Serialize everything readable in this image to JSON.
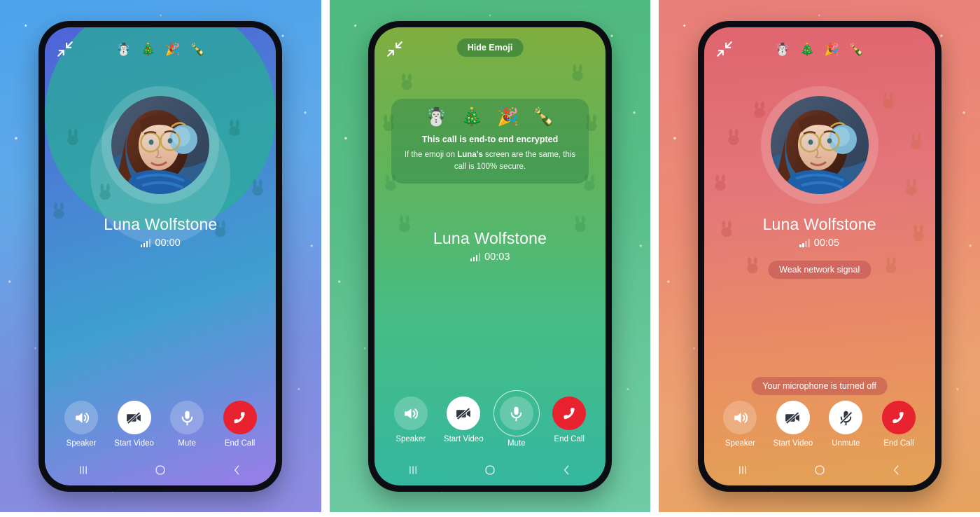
{
  "contact": {
    "name": "Luna Wolfstone",
    "short_name": "Luna"
  },
  "panels": [
    {
      "id": "panel-connecting",
      "theme": "blue-purple",
      "timer": "00:00",
      "name": "Luna Wolfstone",
      "top_emoji": [
        "☃️",
        "🎄",
        "🎉",
        "🍾"
      ],
      "show_avatar": true,
      "show_emoji_card": false,
      "hide_emoji_label": "",
      "badges": [],
      "signal": "full",
      "controls": [
        {
          "label": "Speaker",
          "icon": "speaker-icon",
          "style": "translucent",
          "focused": false
        },
        {
          "label": "Start Video",
          "icon": "video-off-icon",
          "style": "white",
          "focused": false
        },
        {
          "label": "Mute",
          "icon": "mic-icon",
          "style": "translucent",
          "focused": false
        },
        {
          "label": "End Call",
          "icon": "end-call-icon",
          "style": "red",
          "focused": false
        }
      ]
    },
    {
      "id": "panel-encryption",
      "theme": "green",
      "timer": "00:03",
      "name": "Luna Wolfstone",
      "top_emoji": [],
      "show_avatar": false,
      "show_emoji_card": true,
      "hide_emoji_label": "Hide Emoji",
      "encryption": {
        "emoji": [
          "☃️",
          "🎄",
          "🎉",
          "🍾"
        ],
        "title": "This call is end-to end encrypted",
        "subtitle_before": "If the emoji on ",
        "subtitle_bold": "Luna's",
        "subtitle_after": " screen are the same, this call is 100% secure."
      },
      "badges": [],
      "signal": "full",
      "controls": [
        {
          "label": "Speaker",
          "icon": "speaker-icon",
          "style": "translucent",
          "focused": false
        },
        {
          "label": "Start Video",
          "icon": "video-off-icon",
          "style": "white",
          "focused": false
        },
        {
          "label": "Mute",
          "icon": "mic-icon",
          "style": "translucent",
          "focused": true
        },
        {
          "label": "End Call",
          "icon": "end-call-icon",
          "style": "red",
          "focused": false
        }
      ]
    },
    {
      "id": "panel-muted-weak-signal",
      "theme": "red-orange",
      "timer": "00:05",
      "name": "Luna Wolfstone",
      "top_emoji": [
        "☃️",
        "🎄",
        "🎉",
        "🍾"
      ],
      "show_avatar": true,
      "show_emoji_card": false,
      "hide_emoji_label": "",
      "badges": [
        {
          "name": "weak-signal-badge",
          "text": "Weak network signal",
          "position": "under-timer"
        },
        {
          "name": "mic-off-toast",
          "text": "Your microphone is turned off",
          "position": "above-controls"
        }
      ],
      "signal": "weak",
      "controls": [
        {
          "label": "Speaker",
          "icon": "speaker-icon",
          "style": "translucent",
          "focused": false
        },
        {
          "label": "Start Video",
          "icon": "video-off-icon",
          "style": "white",
          "focused": false
        },
        {
          "label": "Unmute",
          "icon": "mic-off-icon",
          "style": "white",
          "focused": false
        },
        {
          "label": "End Call",
          "icon": "end-call-icon",
          "style": "red",
          "focused": false
        }
      ]
    }
  ],
  "navbar": {
    "recents": "recents-icon",
    "home": "home-icon",
    "back": "back-icon"
  },
  "colors": {
    "end_call": "#e8232f",
    "panel1_bg_top": "#4ca3ec",
    "panel1_bg_bottom": "#8f8ae2",
    "panel2_bg_top": "#4fb97e",
    "panel2_bg_bottom": "#6fcba6",
    "panel3_bg_top": "#e87e7a",
    "panel3_bg_bottom": "#e6a35f"
  }
}
